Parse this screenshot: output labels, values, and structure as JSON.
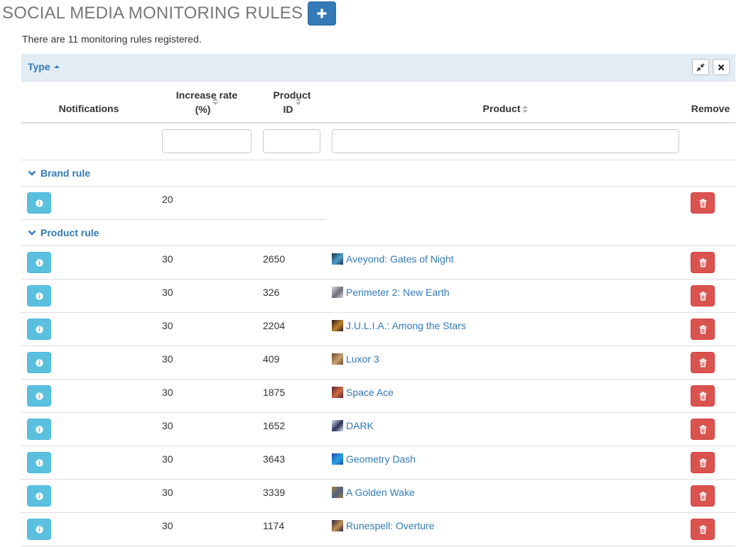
{
  "page": {
    "title": "SOCIAL MEDIA MONITORING RULES",
    "summary": "There are 11 monitoring rules registered."
  },
  "groupbar": {
    "label": "Type"
  },
  "columns": {
    "notifications": "Notifications",
    "rate_line1": "Increase rate",
    "rate_line2": "(%)",
    "pid_line1": "Product",
    "pid_line2": "ID",
    "product": "Product",
    "remove": "Remove"
  },
  "groups": [
    {
      "label": "Brand rule",
      "rows": [
        {
          "rate": "20",
          "product_id": "",
          "product": ""
        }
      ]
    },
    {
      "label": "Product rule",
      "rows": [
        {
          "rate": "30",
          "product_id": "2650",
          "product": "Aveyond: Gates of Night",
          "thumb": [
            "#1c2f4e",
            "#4aa0c8"
          ]
        },
        {
          "rate": "30",
          "product_id": "326",
          "product": "Perimeter 2: New Earth",
          "thumb": [
            "#d8d8dc",
            "#6b6b76"
          ]
        },
        {
          "rate": "30",
          "product_id": "2204",
          "product": "J.U.L.I.A.: Among the Stars",
          "thumb": [
            "#2a1a10",
            "#c08030"
          ]
        },
        {
          "rate": "30",
          "product_id": "409",
          "product": "Luxor 3",
          "thumb": [
            "#6a4a30",
            "#c6a070"
          ]
        },
        {
          "rate": "30",
          "product_id": "1875",
          "product": "Space Ace",
          "thumb": [
            "#5a2030",
            "#d06a40"
          ]
        },
        {
          "rate": "30",
          "product_id": "1652",
          "product": "DARK",
          "thumb": [
            "#dfe4ee",
            "#28305a"
          ]
        },
        {
          "rate": "30",
          "product_id": "3643",
          "product": "Geometry Dash",
          "thumb": [
            "#1a4ab0",
            "#2aa0e0"
          ]
        },
        {
          "rate": "30",
          "product_id": "3339",
          "product": "A Golden Wake",
          "thumb": [
            "#a08040",
            "#506080"
          ]
        },
        {
          "rate": "30",
          "product_id": "1174",
          "product": "Runespell: Overture",
          "thumb": [
            "#30204a",
            "#c09050"
          ]
        }
      ]
    }
  ],
  "colors": {
    "primary": "#337ab7",
    "info": "#5bc0de",
    "danger": "#d9534f",
    "groupbar_bg": "#e1ecf4"
  },
  "icons": {
    "add": "plus-icon",
    "info": "info-circle-icon",
    "remove": "trash-icon",
    "collapse": "compress-icon",
    "close": "close-icon",
    "group_toggle": "chevron-down-icon"
  }
}
